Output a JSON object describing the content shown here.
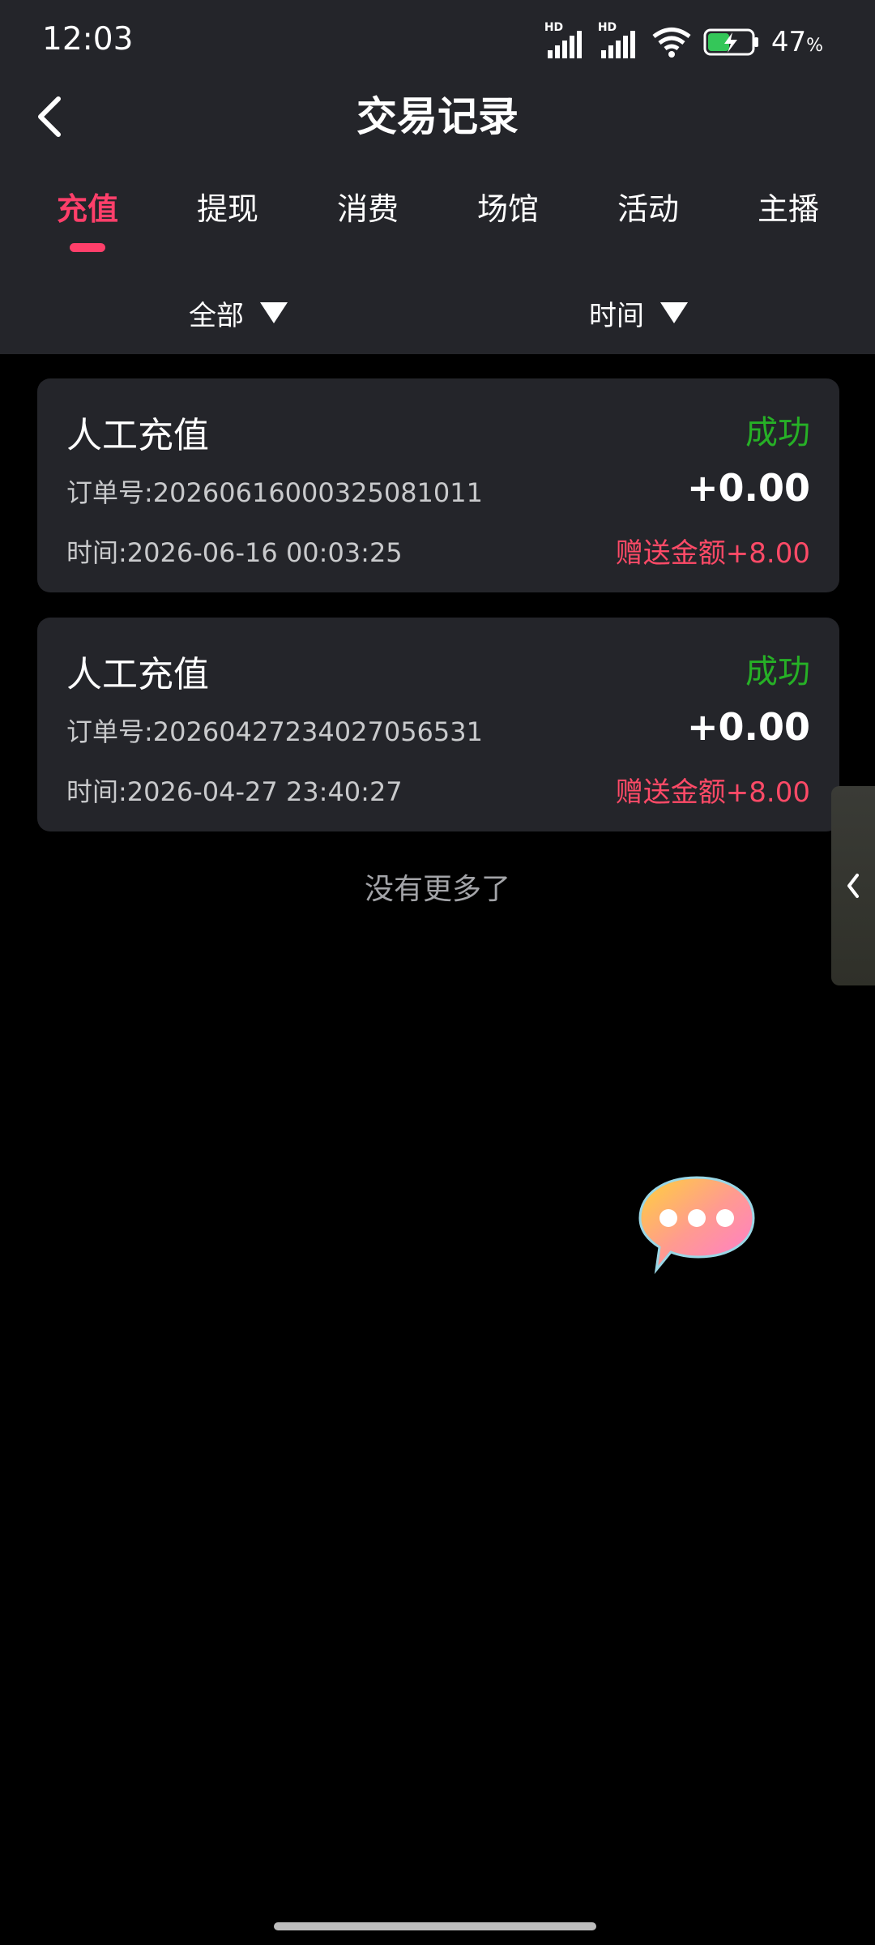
{
  "status_bar": {
    "time": "12:03",
    "signal1_label": "HD",
    "signal2_label": "HD",
    "battery_percent": "47",
    "battery_unit": "%",
    "icons": [
      "signal-icon",
      "signal-icon",
      "wifi-icon",
      "battery-charging-icon"
    ]
  },
  "header": {
    "title": "交易记录",
    "back_icon": "chevron-left-icon"
  },
  "tabs": [
    {
      "label": "充值",
      "active": true
    },
    {
      "label": "提现",
      "active": false
    },
    {
      "label": "消费",
      "active": false
    },
    {
      "label": "场馆",
      "active": false
    },
    {
      "label": "活动",
      "active": false
    },
    {
      "label": "主播",
      "active": false
    }
  ],
  "filters": {
    "category": "全部",
    "time": "时间"
  },
  "records": [
    {
      "type": "人工充值",
      "status": "成功",
      "order_label": "订单号:",
      "order_no": "20260616000325081011",
      "amount": "+0.00",
      "time_label": "时间:",
      "time": "2026-06-16 00:03:25",
      "bonus": "赠送金额+8.00"
    },
    {
      "type": "人工充值",
      "status": "成功",
      "order_label": "订单号:",
      "order_no": "20260427234027056531",
      "amount": "+0.00",
      "time_label": "时间:",
      "time": "2026-04-27 23:40:27",
      "bonus": "赠送金额+8.00"
    }
  ],
  "list_end_text": "没有更多了",
  "colors": {
    "accent": "#ff3f6a",
    "success": "#26b026",
    "bonus": "#ff4a67",
    "panel": "#24252a",
    "background": "#000000"
  }
}
